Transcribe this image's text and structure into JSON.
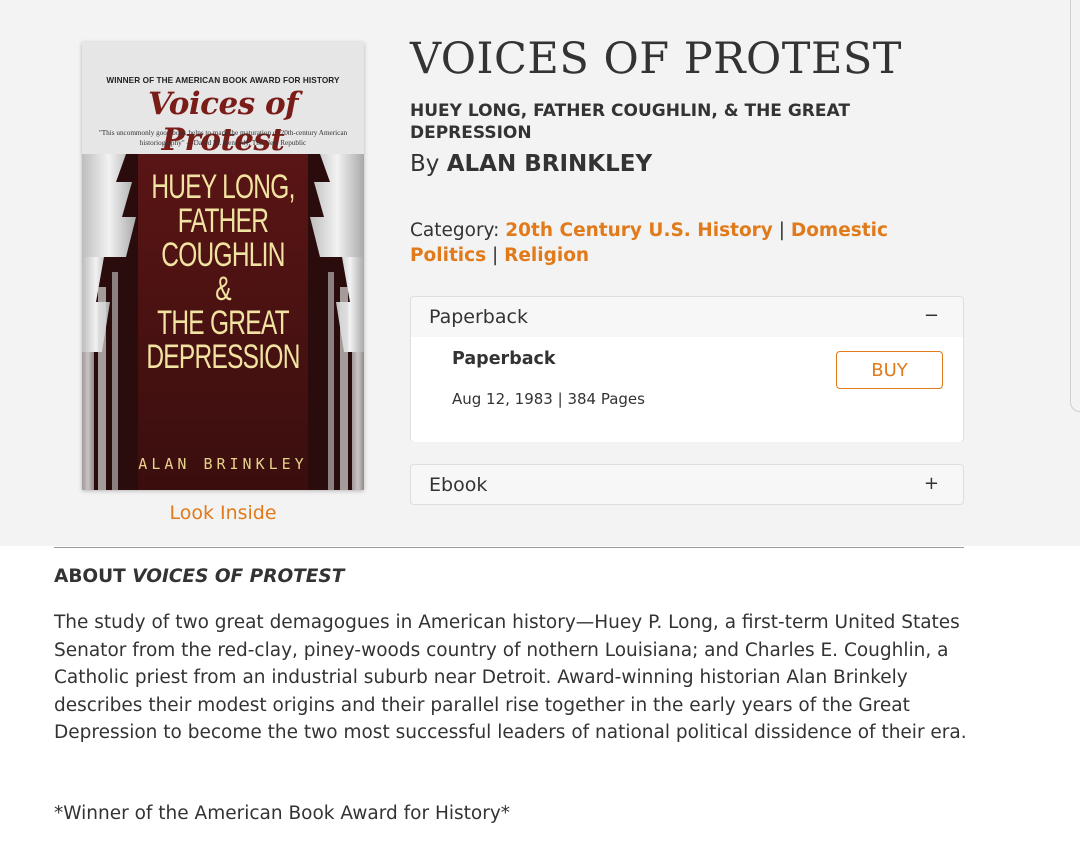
{
  "cover": {
    "award_line": "WINNER OF THE AMERICAN BOOK AWARD FOR HISTORY",
    "title": "Voices of Protest",
    "quote": "\"This uncommonly good book helps to mark the maturation of 20th-century American historiography\" —David M. Kennedy, The New Republic",
    "main_lines": [
      "HUEY LONG,",
      "FATHER",
      "COUGHLIN",
      "&",
      "THE GREAT",
      "DEPRESSION"
    ],
    "author": "ALAN BRINKLEY",
    "colors": {
      "background": "#3a1212",
      "title": "#7a1c18",
      "lettering": "#f1e3a1"
    }
  },
  "look_inside": "Look Inside",
  "book": {
    "title": "VOICES OF PROTEST",
    "subtitle": "HUEY LONG, FATHER COUGHLIN, & THE GREAT DEPRESSION",
    "by_prefix": "By",
    "author": "ALAN BRINKLEY"
  },
  "category": {
    "label": "Category:",
    "items": [
      "20th Century U.S. History",
      "Domestic Politics",
      "Religion"
    ],
    "separator": "|"
  },
  "formats": [
    {
      "header": "Paperback",
      "toggle": "−",
      "expanded": true,
      "name": "Paperback",
      "meta": "Aug 12, 1983 | 384 Pages",
      "buy_label": "BUY"
    },
    {
      "header": "Ebook",
      "toggle": "+",
      "expanded": false
    }
  ],
  "about": {
    "heading_prefix": "ABOUT",
    "heading_title": "VOICES OF PROTEST",
    "body": "The study of two great demagogues in American history—Huey P. Long, a first-term United States Senator from the red-clay, piney-woods country of nothern Louisiana; and Charles E. Coughlin, a Catholic priest from an industrial suburb near Detroit. Award-winning historian Alan Brinkely describes their modest origins and their parallel rise together in the early years of the Great Depression to become the two most successful leaders of national political dissidence of their era.",
    "award": "*Winner of the American Book Award for History*"
  },
  "colors": {
    "accent": "#e07a1a",
    "hero_bg": "#f3f3f3",
    "text": "#333333"
  }
}
